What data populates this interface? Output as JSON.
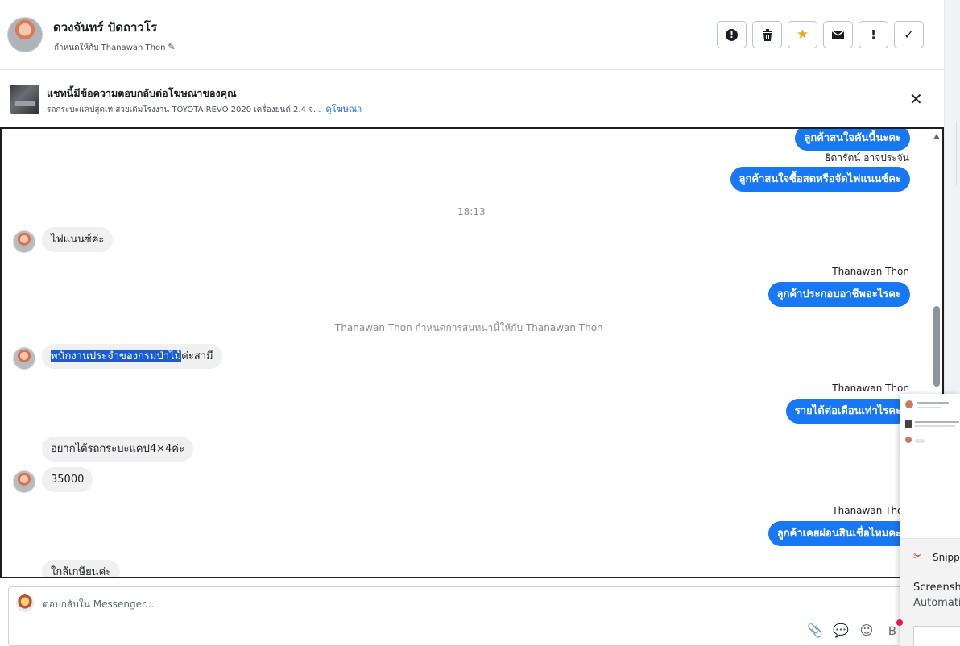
{
  "header": {
    "contact_name": "ดวงจันทร์ ปัดถาวโร",
    "assigned_text": "กำหนดให้กับ Thanawan Thon",
    "buttons": [
      {
        "name": "spam",
        "icon": "exclamation-circle-icon"
      },
      {
        "name": "delete",
        "icon": "trash-icon"
      },
      {
        "name": "star",
        "icon": "star-icon",
        "color": "#f5a623"
      },
      {
        "name": "mark-unread",
        "icon": "envelope-icon"
      },
      {
        "name": "follow-up",
        "icon": "exclamation-icon"
      },
      {
        "name": "done",
        "icon": "check-icon"
      }
    ]
  },
  "ad": {
    "title": "แชทนี้มีข้อความตอบกลับต่อโฆษณาของคุณ",
    "subtitle": "รถกระบะแคปสุดเท่ สวยเดิมโรงงาน TOYOTA REVO 2020 เครื่องยนต์ 2.4 จ...",
    "link": "ดูโฆษณา"
  },
  "messages": {
    "m1": "ลูกค้าสนใจคันนี้นะคะ",
    "s1": "ธิดารัตน์ อาจประจัน",
    "m2": "ลูกค้าสนใจซื้อสดหรือจัดไฟแนนซ์คะ",
    "time1": "18:13",
    "in1": "ไฟแนนซ์ค่ะ",
    "s2": "Thanawan Thon",
    "m3": "ลุกค้าประกอบอาชีพอะไรคะ",
    "notice": "Thanawan Thon กำหนดการสนทนานี้ให้กับ Thanawan Thon",
    "in2_selected": "พนักงานประจำของกรมป่าไม้",
    "in2_rest": "ค่ะสามี",
    "s3": "Thanawan Thon",
    "m4": "รายได้ต่อเดือนเท่าไรคะ",
    "in3": "อยากได้รถกระบะแคป4×4ค่ะ",
    "in4": "35000",
    "s4": "Thanawan Thon",
    "m5": "ลูกค้าเคยผ่อนสินเชื่อไหมคะ",
    "in5": "ใกล้เกษียนค่ะ"
  },
  "composer": {
    "placeholder": "ตอบกลับใน Messenger..."
  },
  "overlay": {
    "app_title": "Snipping Tool",
    "line1": "Screenshot copied",
    "line2": "Automatically saved"
  },
  "colors": {
    "outgoing_bubble": "#1877f2",
    "incoming_bubble": "#f0f0f0",
    "selection": "#1a5ccc"
  }
}
